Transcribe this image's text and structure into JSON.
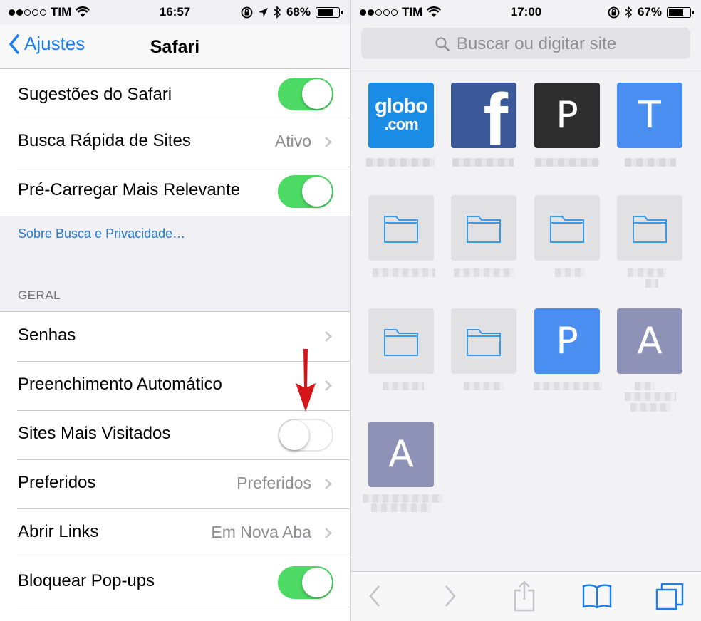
{
  "left": {
    "status": {
      "carrier": "TIM",
      "time": "16:57",
      "battery": "68%",
      "battery_level": 0.68
    },
    "nav": {
      "back_label": "Ajustes",
      "title": "Safari"
    },
    "group1": [
      {
        "label": "Sugestões do Safari",
        "toggle": true
      },
      {
        "label": "Busca Rápida de Sites",
        "value": "Ativo"
      },
      {
        "label": "Pré-Carregar Mais Relevante",
        "toggle": true
      }
    ],
    "privacy_link": "Sobre Busca e Privacidade…",
    "section_header": "GERAL",
    "group2": [
      {
        "label": "Senhas"
      },
      {
        "label": "Preenchimento Automático"
      },
      {
        "label": "Sites Mais Visitados",
        "toggle": false
      },
      {
        "label": "Preferidos",
        "value": "Preferidos"
      },
      {
        "label": "Abrir Links",
        "value": "Em Nova Aba"
      },
      {
        "label": "Bloquear Pop-ups",
        "toggle": true
      }
    ],
    "colors": {
      "toggle_on": "#4cd964",
      "link": "#2779c6",
      "back": "#1a7df2",
      "arrow": "#d7161c"
    }
  },
  "right": {
    "status": {
      "carrier": "TIM",
      "time": "17:00",
      "battery": "67%",
      "battery_level": 0.67
    },
    "search_placeholder": "Buscar ou digitar site",
    "favorites": [
      {
        "kind": "globo",
        "text": "globo",
        "subtext": ".com",
        "color": "#1a8ce6"
      },
      {
        "kind": "facebook",
        "letter": "f",
        "color": "#3b5998"
      },
      {
        "kind": "letter",
        "letter": "P",
        "color": "#2d2d2d"
      },
      {
        "kind": "letter",
        "letter": "T",
        "color": "#4a8ef2"
      },
      {
        "kind": "folder"
      },
      {
        "kind": "folder"
      },
      {
        "kind": "folder"
      },
      {
        "kind": "folder"
      },
      {
        "kind": "folder"
      },
      {
        "kind": "folder"
      },
      {
        "kind": "letter",
        "letter": "P",
        "color": "#4a8ef2"
      },
      {
        "kind": "letter",
        "letter": "A",
        "color": "#8e92b6"
      },
      {
        "kind": "letter",
        "letter": "A",
        "color": "#8e92b6"
      }
    ],
    "toolbar_icons": [
      "back-icon",
      "forward-icon",
      "share-icon",
      "bookmarks-icon",
      "tabs-icon"
    ]
  }
}
